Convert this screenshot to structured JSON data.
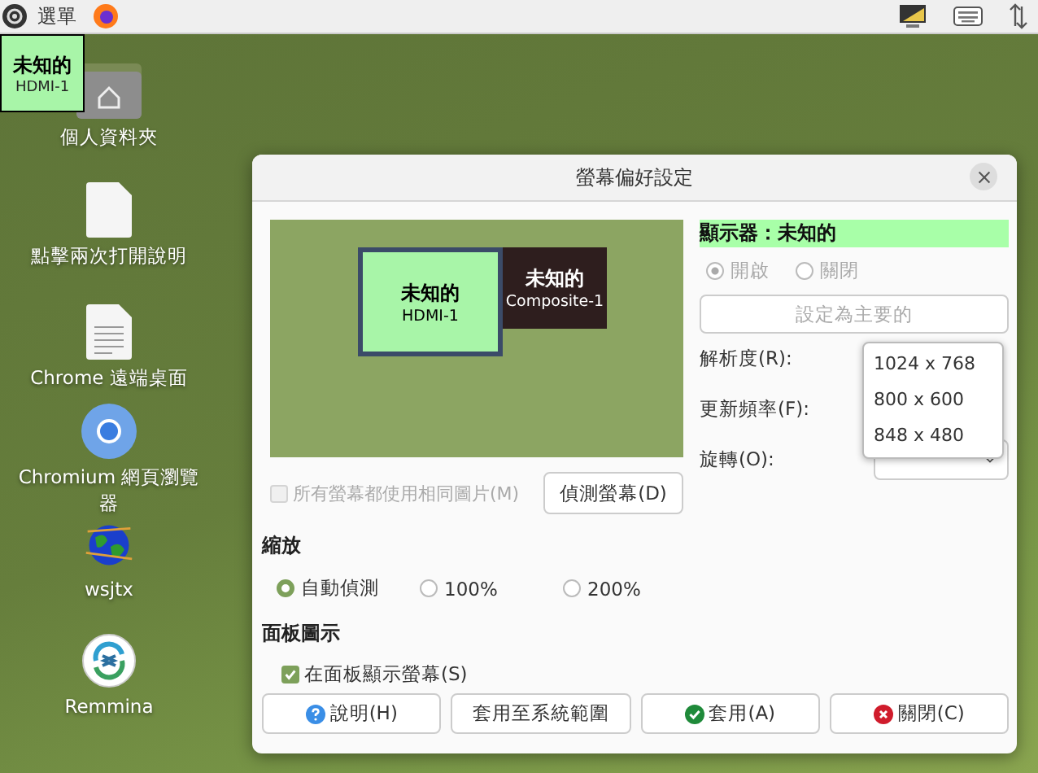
{
  "top_bar": {
    "menu_label": "選單"
  },
  "monitor_tooltip": {
    "name": "未知的",
    "output": "HDMI-1"
  },
  "desktop_icons": [
    {
      "kind": "home-folder",
      "label": "個人資料夾"
    },
    {
      "kind": "document",
      "label": "點擊兩次打開說明"
    },
    {
      "kind": "text-file",
      "label": "Chrome 遠端桌面"
    },
    {
      "kind": "chromium",
      "label": "Chromium 網頁瀏覽器"
    },
    {
      "kind": "globe",
      "label": "wsjtx"
    },
    {
      "kind": "remmina",
      "label": "Remmina"
    }
  ],
  "dialog": {
    "title": "螢幕偏好設定",
    "monitors": [
      {
        "name": "未知的",
        "output": "HDMI-1",
        "selected": true
      },
      {
        "name": "未知的",
        "output": "Composite-1",
        "selected": false
      }
    ],
    "same_image": {
      "label": "所有螢幕都使用相同圖片(M)",
      "checked": false,
      "disabled": true
    },
    "detect_button": "偵測螢幕(D)",
    "display_header": "顯示器：未知的",
    "power_disabled": true,
    "power": [
      {
        "label": "開啟",
        "selected": true
      },
      {
        "label": "關閉",
        "selected": false
      }
    ],
    "primary_button": {
      "label": "設定為主要的",
      "disabled": true
    },
    "resolution_label": "解析度(R):",
    "refresh_label": "更新頻率(F):",
    "rotation_label": "旋轉(O):",
    "resolution_options": [
      "1024 x 768",
      "800 x 600",
      "848 x 480"
    ],
    "scale_heading": "縮放",
    "scale_options": [
      {
        "label": "自動偵測",
        "selected": true
      },
      {
        "label": "100%",
        "selected": false
      },
      {
        "label": "200%",
        "selected": false
      }
    ],
    "panel_heading": "面板圖示",
    "panel_checkbox": {
      "label": "在面板顯示螢幕(S)",
      "checked": true
    },
    "buttons": [
      {
        "kind": "help",
        "label": "說明(H)"
      },
      {
        "kind": "plain",
        "label": "套用至系統範圍"
      },
      {
        "kind": "apply",
        "label": "套用(A)"
      },
      {
        "kind": "close",
        "label": "關閉(C)"
      }
    ]
  }
}
